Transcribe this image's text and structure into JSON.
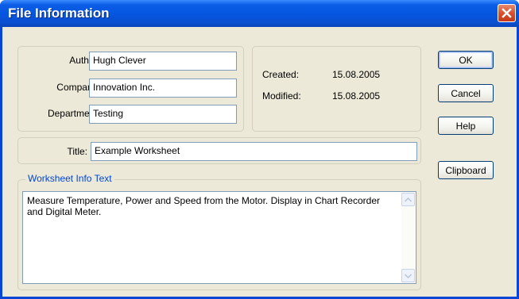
{
  "window": {
    "title": "File Information"
  },
  "author_group": {
    "author_label": "Author:",
    "author_value": "Hugh Clever",
    "company_label": "Company:",
    "company_value": "Innovation Inc.",
    "department_label": "Department:",
    "department_value": "Testing"
  },
  "dates_group": {
    "created_label": "Created:",
    "created_value": "15.08.2005",
    "modified_label": "Modified:",
    "modified_value": "15.08.2005"
  },
  "title_group": {
    "title_label": "Title:",
    "title_value": "Example Worksheet"
  },
  "info_group": {
    "legend": "Worksheet Info Text",
    "text": "Measure Temperature, Power and Speed from the Motor. Display in Chart Recorder and Digital Meter."
  },
  "buttons": {
    "ok": "OK",
    "cancel": "Cancel",
    "help": "Help",
    "clipboard": "Clipboard"
  },
  "icons": {
    "close": "close-icon",
    "scroll_up": "scroll-up-icon",
    "scroll_down": "scroll-down-icon"
  },
  "colors": {
    "titlebar": "#0556e0",
    "close_button": "#d8502f",
    "dialog_background": "#ece9d8",
    "legend_text": "#0046d5"
  }
}
